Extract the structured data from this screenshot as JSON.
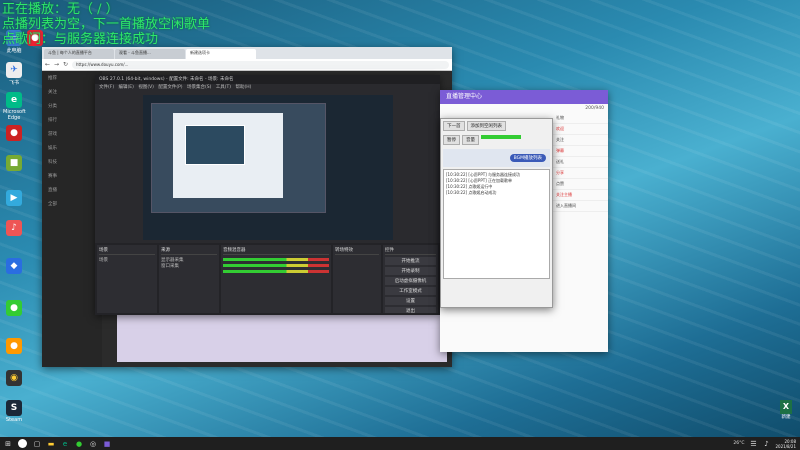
{
  "overlay": {
    "line1": "正在播放：无（ / ）",
    "line2": "点播列表为空，下一首播放空闲歌单",
    "line3": "点歌门：与服务器连接成功"
  },
  "desktop_icons": [
    {
      "label": "此电脑",
      "color": "#3a7bd5",
      "glyph": "▭"
    },
    {
      "label": "回收站",
      "color": "#8aa",
      "glyph": "♺"
    },
    {
      "label": "",
      "color": "#e23",
      "glyph": "●"
    },
    {
      "label": "飞书",
      "color": "#2a6de1",
      "glyph": "✈"
    },
    {
      "label": "Microsoft Edge",
      "color": "#0b8",
      "glyph": "e"
    },
    {
      "label": "",
      "color": "#c22",
      "glyph": "●"
    },
    {
      "label": "",
      "color": "#7a3",
      "glyph": "■"
    },
    {
      "label": "",
      "color": "#3ad",
      "glyph": "▶"
    },
    {
      "label": "",
      "color": "#e55",
      "glyph": "♪"
    },
    {
      "label": "",
      "color": "#f90",
      "glyph": "●"
    },
    {
      "label": "",
      "color": "#333",
      "glyph": "◉"
    },
    {
      "label": "Steam",
      "color": "#1b2838",
      "glyph": "S"
    }
  ],
  "browser": {
    "tabs": [
      "斗鱼 | 每个人的直播平台",
      "观看 - 斗鱼直播...",
      "新建选项卡"
    ],
    "url": "https://www.douyu.com/...",
    "sidebar": [
      "推荐",
      "关注",
      "分类",
      "排行",
      "游戏",
      "娱乐",
      "科技",
      "赛事",
      "直播",
      "全部"
    ]
  },
  "obs": {
    "title": "OBS 27.0.1 (64-bit, windows) - 配置文件: 未命名 - 场景: 未命名",
    "menu": "文件(F)  编辑(E)  视图(V)  配置文件(P)  场景集合(S)  工具(T)  帮助(H)",
    "panels": {
      "scenes": "场景",
      "sources": "来源",
      "mixer": "音频混音器",
      "transitions": "转场特效",
      "controls": "控件"
    },
    "scene_item": "场景",
    "source_items": [
      "显示器采集",
      "窗口采集"
    ],
    "control_buttons": [
      "开始推流",
      "开始录制",
      "启动虚拟摄像机",
      "工作室模式",
      "设置",
      "退出"
    ]
  },
  "tool": {
    "buttons": [
      "下一首",
      "添加到空闲列表",
      "暂停",
      "音量"
    ],
    "banner_btn": "BGM播放列表",
    "log": [
      "[10:30:22] [心愿PPT] 与服务器连接成功",
      "[10:30:22] [心愿PPT] 正在加载歌单",
      "[10:30:22] 点歌姬运行中",
      "[10:30:22] 点歌姬启动成功"
    ]
  },
  "purple": {
    "title": "直播管理中心",
    "count": "200/940",
    "items": [
      "礼物",
      "欢迎",
      "关注",
      "弹幕",
      "送礼",
      "分享",
      "点赞",
      "关注主播",
      "进入直播间"
    ]
  },
  "taskbar": {
    "temp": "26°C",
    "clock_time": "20:08",
    "clock_date": "2021/8/21"
  },
  "excel_label": "新建"
}
